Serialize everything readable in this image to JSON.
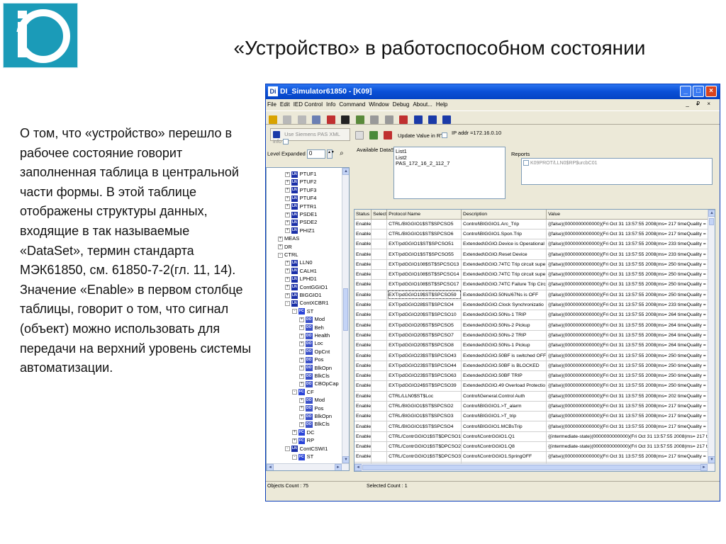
{
  "slide": {
    "title": "«Устройство» в работоспособном состоянии",
    "body": "О том, что «устройство» перешло в рабочее состояние говорит заполненная таблица в центральной части формы. В этой таблице отображены структуры данных, входящие в так называемые «DataSet», термин стандарта  МЭК61850, см. 61850-7-2(гл. 11, 14). Значение «Enable» в первом столбце таблицы, говорит о том, что сигнал (объект) можно использовать для передачи на верхний уровень системы автоматизации."
  },
  "window": {
    "title": "DI_Simulator61850 - [K09]",
    "app_icon": "Di",
    "menu": [
      "File",
      "Edit",
      "IED Control",
      "Info",
      "Command",
      "Window",
      "Debug",
      "About...",
      "Help"
    ],
    "mdi_buttons": "_ ₽ ×"
  },
  "toolbar2": {
    "use_siemens_label": "Use Siemens PAS XML info",
    "update_value_label": "Update Value in RT",
    "ip_addr": "IP addr =172.16.0.10"
  },
  "level": {
    "label": "Level Expanded",
    "value": "0"
  },
  "tree": [
    {
      "indent": 2,
      "pm": "+",
      "tag": "LN",
      "label": "PTUF1"
    },
    {
      "indent": 2,
      "pm": "+",
      "tag": "LN",
      "label": "PTUF2"
    },
    {
      "indent": 2,
      "pm": "+",
      "tag": "LN",
      "label": "PTUF3"
    },
    {
      "indent": 2,
      "pm": "+",
      "tag": "LN",
      "label": "PTUF4"
    },
    {
      "indent": 2,
      "pm": "+",
      "tag": "LN",
      "label": "PTTR1"
    },
    {
      "indent": 2,
      "pm": "+",
      "tag": "LN",
      "label": "PSDE1"
    },
    {
      "indent": 2,
      "pm": "+",
      "tag": "LN",
      "label": "PSDE2"
    },
    {
      "indent": 2,
      "pm": "+",
      "tag": "LN",
      "label": "PHIZ1"
    },
    {
      "indent": 1,
      "pm": "+",
      "tag": "",
      "label": "MEAS"
    },
    {
      "indent": 1,
      "pm": "+",
      "tag": "",
      "label": "DR"
    },
    {
      "indent": 1,
      "pm": "-",
      "tag": "",
      "label": "CTRL"
    },
    {
      "indent": 2,
      "pm": "+",
      "tag": "LN",
      "label": "LLN0"
    },
    {
      "indent": 2,
      "pm": "+",
      "tag": "LN",
      "label": "CALH1"
    },
    {
      "indent": 2,
      "pm": "+",
      "tag": "LN",
      "label": "LPHD1"
    },
    {
      "indent": 2,
      "pm": "+",
      "tag": "LN",
      "label": "ContGGIO1"
    },
    {
      "indent": 2,
      "pm": "+",
      "tag": "LN",
      "label": "BIGGIO1"
    },
    {
      "indent": 2,
      "pm": "-",
      "tag": "LN",
      "label": "ContXCBR1"
    },
    {
      "indent": 3,
      "pm": "-",
      "tag": "FC",
      "label": "ST"
    },
    {
      "indent": 4,
      "pm": "+",
      "tag": "DO",
      "label": "Mod"
    },
    {
      "indent": 4,
      "pm": "+",
      "tag": "DO",
      "label": "Beh"
    },
    {
      "indent": 4,
      "pm": "+",
      "tag": "DO",
      "label": "Health"
    },
    {
      "indent": 4,
      "pm": "+",
      "tag": "DO",
      "label": "Loc"
    },
    {
      "indent": 4,
      "pm": "+",
      "tag": "DO",
      "label": "OpCnt"
    },
    {
      "indent": 4,
      "pm": "+",
      "tag": "DO",
      "label": "Pos"
    },
    {
      "indent": 4,
      "pm": "+",
      "tag": "DO",
      "label": "BlkOpn"
    },
    {
      "indent": 4,
      "pm": "+",
      "tag": "DO",
      "label": "BlkCls"
    },
    {
      "indent": 4,
      "pm": "+",
      "tag": "DO",
      "label": "CBOpCap"
    },
    {
      "indent": 3,
      "pm": "-",
      "tag": "FC",
      "label": "CF"
    },
    {
      "indent": 4,
      "pm": "+",
      "tag": "DO",
      "label": "Mod"
    },
    {
      "indent": 4,
      "pm": "+",
      "tag": "DO",
      "label": "Pos"
    },
    {
      "indent": 4,
      "pm": "+",
      "tag": "DO",
      "label": "BlkOpn"
    },
    {
      "indent": 4,
      "pm": "+",
      "tag": "DO",
      "label": "BlkCls"
    },
    {
      "indent": 3,
      "pm": "+",
      "tag": "FC",
      "label": "DC"
    },
    {
      "indent": 3,
      "pm": "+",
      "tag": "FC",
      "label": "RP"
    },
    {
      "indent": 2,
      "pm": "-",
      "tag": "LN",
      "label": "ContCSWI1"
    },
    {
      "indent": 3,
      "pm": "-",
      "tag": "FC",
      "label": "ST"
    }
  ],
  "dataset": {
    "label": "Available DataSet",
    "items": [
      "List1",
      "List2",
      "PAS_172_16_2_112_7"
    ]
  },
  "reports": {
    "label": "Reports",
    "item": "K09PROT/LLN0$RP$urcbC01"
  },
  "grid": {
    "columns": [
      "Status",
      "Select",
      "Protocol Name",
      "Description",
      "Value"
    ],
    "rows": [
      [
        "Enable",
        "",
        "CTRL/BIGGIO1$ST$SPCSO5",
        "Control\\BIGGIO1.Arc_Trip",
        "{(false)(0000000000000)(Fri Oct 31 13:57:55 2008(ms= 217 timeQuality = a)}"
      ],
      [
        "Enable",
        "",
        "CTRL/BIGGIO1$ST$SPCSO6",
        "Control\\BIGGIO1.Spon.Trip",
        "{(false)(0000000000000)(Fri Oct 31 13:57:55 2008(ms= 217 timeQuality = a)}"
      ],
      [
        "Enable",
        "",
        "EXT/pdGGIO1$ST$SPCSO51",
        "Extended\\GGIO.Device is Operational",
        "{(false)(0000000000000)(Fri Oct 31 13:57:55 2008(ms= 233 timeQuality = a)}"
      ],
      [
        "Enable",
        "",
        "EXT/pdGGIO1$ST$SPCSO55",
        "Extended\\GGIO.Reset Device",
        "{(false)(0000000000000)(Fri Oct 31 13:57:55 2008(ms= 233 timeQuality = a)}"
      ],
      [
        "Enable",
        "",
        "EXT/pdGGIO108$ST$SPCSO13",
        "Extended\\GGIO.74TC Trip circuit supe",
        "{(false)(0000000000000)(Fri Oct 31 13:57:55 2008(ms= 250 timeQuality = a)}"
      ],
      [
        "Enable",
        "",
        "EXT/pdGGIO108$ST$SPCSO14",
        "Extended\\GGIO.74TC Trip circuit supe",
        "{(false)(0000000000000)(Fri Oct 31 13:57:55 2008(ms= 250 timeQuality = a)}"
      ],
      [
        "Enable",
        "",
        "EXT/pdGGIO108$ST$SPCSO17",
        "Extended\\GGIO.74TC Failure Trip Circ",
        "{(false)(0000000000000)(Fri Oct 31 13:57:55 2008(ms= 250 timeQuality = a)}"
      ],
      [
        "Enable",
        "",
        "EXT/pdGGIO19$ST$SPCSO59",
        "Extended\\GGIO.50Ns/67Ns is OFF",
        "{(false)(0000000000000)(Fri Oct 31 13:57:55 2008(ms= 250 timeQuality = a)}"
      ],
      [
        "Enable",
        "",
        "EXT/pdGGIO28$ST$SPCSO4",
        "Extended\\GGIO.Clock Synchronizatio",
        "{(false)(0000000000000)(Fri Oct 31 13:57:55 2008(ms= 233 timeQuality = a)}"
      ],
      [
        "Enable",
        "",
        "EXT/pdGGIO20$ST$SPCSO10",
        "Extended\\GGIO.50Ns-1 TRIP",
        "{(false)(0000000000000)(Fri Oct 31 13:57:55 2008(ms= 264 timeQuality = a)}"
      ],
      [
        "Enable",
        "",
        "EXT/pdGGIO20$ST$SPCSO5",
        "Extended\\GGIO.50Ns-2 Pickup",
        "{(false)(0000000000000)(Fri Oct 31 13:57:55 2008(ms= 264 timeQuality = a)}"
      ],
      [
        "Enable",
        "",
        "EXT/pdGGIO20$ST$SPCSO7",
        "Extended\\GGIO.50Ns-2 TRIP",
        "{(false)(0000000000000)(Fri Oct 31 13:57:55 2008(ms= 264 timeQuality = a)}"
      ],
      [
        "Enable",
        "",
        "EXT/pdGGIO20$ST$SPCSO8",
        "Extended\\GGIO.50Ns-1 Pickup",
        "{(false)(0000000000000)(Fri Oct 31 13:57:55 2008(ms= 264 timeQuality = a)}"
      ],
      [
        "Enable",
        "",
        "EXT/pdGGIO23$ST$SPCSO43",
        "Extended\\GGIO.50BF is switched OFF",
        "{(false)(0000000000000)(Fri Oct 31 13:57:55 2008(ms= 250 timeQuality = a)}"
      ],
      [
        "Enable",
        "",
        "EXT/pdGGIO23$ST$SPCSO44",
        "Extended\\GGIO.50BF is BLOCKED",
        "{(false)(0000000000000)(Fri Oct 31 13:57:55 2008(ms= 250 timeQuality = a)}"
      ],
      [
        "Enable",
        "",
        "EXT/pdGGIO23$ST$SPCSO63",
        "Extended\\GGIO.50BF TRIP",
        "{(false)(0000000000000)(Fri Oct 31 13:57:55 2008(ms= 250 timeQuality = a)}"
      ],
      [
        "Enable",
        "",
        "EXT/pdGGIO24$ST$SPCSO39",
        "Extended\\GGIO.49 Overload Protectio",
        "{(false)(0000000000000)(Fri Oct 31 13:57:55 2008(ms= 250 timeQuality = a)}"
      ],
      [
        "Enable",
        "",
        "CTRL/LLN0$ST$Loc",
        "Control\\General.Control Auth",
        "{(false)(0000000000000)(Fri Oct 31 13:57:55 2008(ms= 202 timeQuality = a)}"
      ],
      [
        "Enable",
        "",
        "CTRL/BIGGIO1$ST$SPCSO2",
        "Control\\BIGGIO1.>T_alarm",
        "{(false)(0000000000000)(Fri Oct 31 13:57:55 2008(ms= 217 timeQuality = a)}"
      ],
      [
        "Enable",
        "",
        "CTRL/BIGGIO1$ST$SPCSO3",
        "Control\\BIGGIO1.>T_trip",
        "{(false)(0000000000000)(Fri Oct 31 13:57:55 2008(ms= 217 timeQuality = a)}"
      ],
      [
        "Enable",
        "",
        "CTRL/BIGGIO1$ST$SPCSO4",
        "Control\\BIGGIO1.MCBsTrip",
        "{(false)(0000000000000)(Fri Oct 31 13:57:55 2008(ms= 217 timeQuality = a)}"
      ],
      [
        "Enable",
        "",
        "CTRL/ContrGGIO1$ST$DPCSO1",
        "Control\\ContrGGIO1.Q1",
        "{(intermediate-state)(0000000000000)(Fri Oct 31 13:57:55 2008(ms= 217 timeQuality = a)}"
      ],
      [
        "Enable",
        "",
        "CTRL/ContrGGIO1$ST$DPCSO2",
        "Control\\ContrGGIO1.Q8",
        "{(intermediate-state)(0000000000000)(Fri Oct 31 13:57:55 2008(ms= 217 timeQuality = a)}"
      ],
      [
        "Enable",
        "",
        "CTRL/ContrGGIO1$ST$DPCSO3",
        "Control\\ContrGGIO1.SpringOFF",
        "{(false)(0000000000000)(Fri Oct 31 13:57:55 2008(ms= 217 timeQuality = a)}"
      ],
      [
        "Enable",
        "",
        "CTRL/ContXCBR1$ST$Pos",
        "Control\\Q0\\XCBR.Position",
        "{(intermediate-state)(0000000000000)(Fri Oct 31 13:57:55 2008(ms= 217 timeQuality = a)}"
      ]
    ],
    "selected_row": 7
  },
  "status": {
    "objects_count": "Objects Count : 75",
    "selected_count": "Selected Count : 1"
  },
  "colors": {
    "logo": "#1b9bb8",
    "titlebar": "#0a4fd6",
    "tag_blue": "#1a2fa8"
  }
}
